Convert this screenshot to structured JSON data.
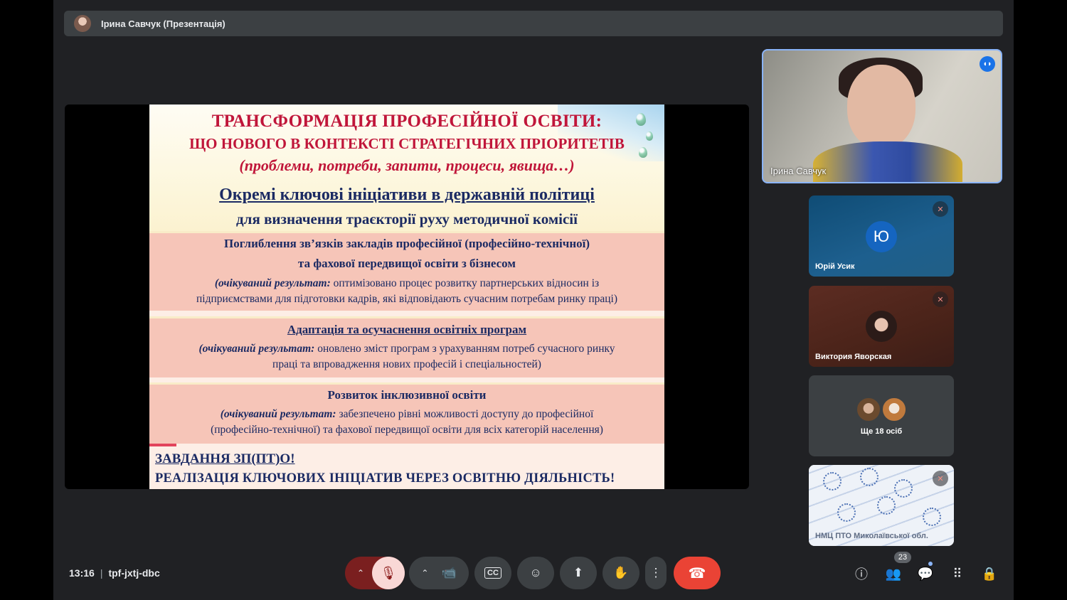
{
  "presenter_bar": {
    "title": "Ірина Савчук (Презентація)"
  },
  "slide": {
    "title1": "ТРАНСФОРМАЦІЯ ПРОФЕСІЙНОЇ ОСВІТИ:",
    "title2": "ЩО НОВОГО В КОНТЕКСТІ СТРАТЕГІЧНИХ ПРІОРИТЕТІВ",
    "title3": "(проблеми, потреби, запити, процеси, явища…)",
    "title4": "Окремі ключові ініціативи в державній політиці",
    "title5": "для визначення траєкторії руху методичної комісії",
    "band1": {
      "h1": "Поглиблення зв’язків закладів професійної (професійно-технічної)",
      "h2": "та фахової передвищої освіти з бізнесом",
      "label": "(очікуваний результат:",
      "p1": " оптимізовано процес розвитку партнерських відносин із",
      "p2": "підприємствами для підготовки кадрів, які відповідають сучасним потребам ринку праці)"
    },
    "band2": {
      "h": "Адаптація та осучаснення освітніх програм",
      "label": "(очікуваний результат:",
      "p1": " оновлено зміст програм з урахуванням потреб сучасного ринку",
      "p2": "праці та впровадження нових професій і спеціальностей)"
    },
    "band3": {
      "h": "Розвиток інклюзивної освіти",
      "label": "(очікуваний результат:",
      "p1": " забезпечено рівні можливості доступу до професійної",
      "p2": "(професійно-технічної) та фахової передвищої освіти для всіх категорій населення)"
    },
    "task1": "ЗАВДАННЯ ЗП(ПТ)О!",
    "task2": "РЕАЛІЗАЦІЯ КЛЮЧОВИХ ІНІЦІАТИВ ЧЕРЕЗ ОСВІТНЮ ДІЯЛЬНІСТЬ!"
  },
  "participants": {
    "main": {
      "name": "Ірина Савчук"
    },
    "p1": {
      "initial": "Ю",
      "name": "Юрій Усик"
    },
    "p2": {
      "name": "Виктория Яворская"
    },
    "p3": {
      "more": "Ще 18 осіб"
    },
    "p4": {
      "name": "НМЦ ПТО Миколаївської обл."
    }
  },
  "bottom_bar": {
    "time": "13:16",
    "separator": "|",
    "meeting_code": "tpf-jxtj-dbc",
    "participant_count": "23"
  },
  "icons": {
    "chevron_up": "⌃",
    "mic_off": "🎙",
    "camera": "📹",
    "captions": "CC",
    "emoji": "☺",
    "present": "⬆",
    "hand": "✋",
    "more": "⋮",
    "end_call": "☎",
    "info": "ⓘ",
    "people": "👥",
    "chat": "💬",
    "activities": "⠿",
    "host_controls": "🔒",
    "speaking": "◖◗",
    "muted": "✕"
  },
  "colors": {
    "accent": "#8ab4f8",
    "end_call": "#ea4335",
    "slide_title": "#c0163a",
    "slide_text": "#1b2a63"
  }
}
